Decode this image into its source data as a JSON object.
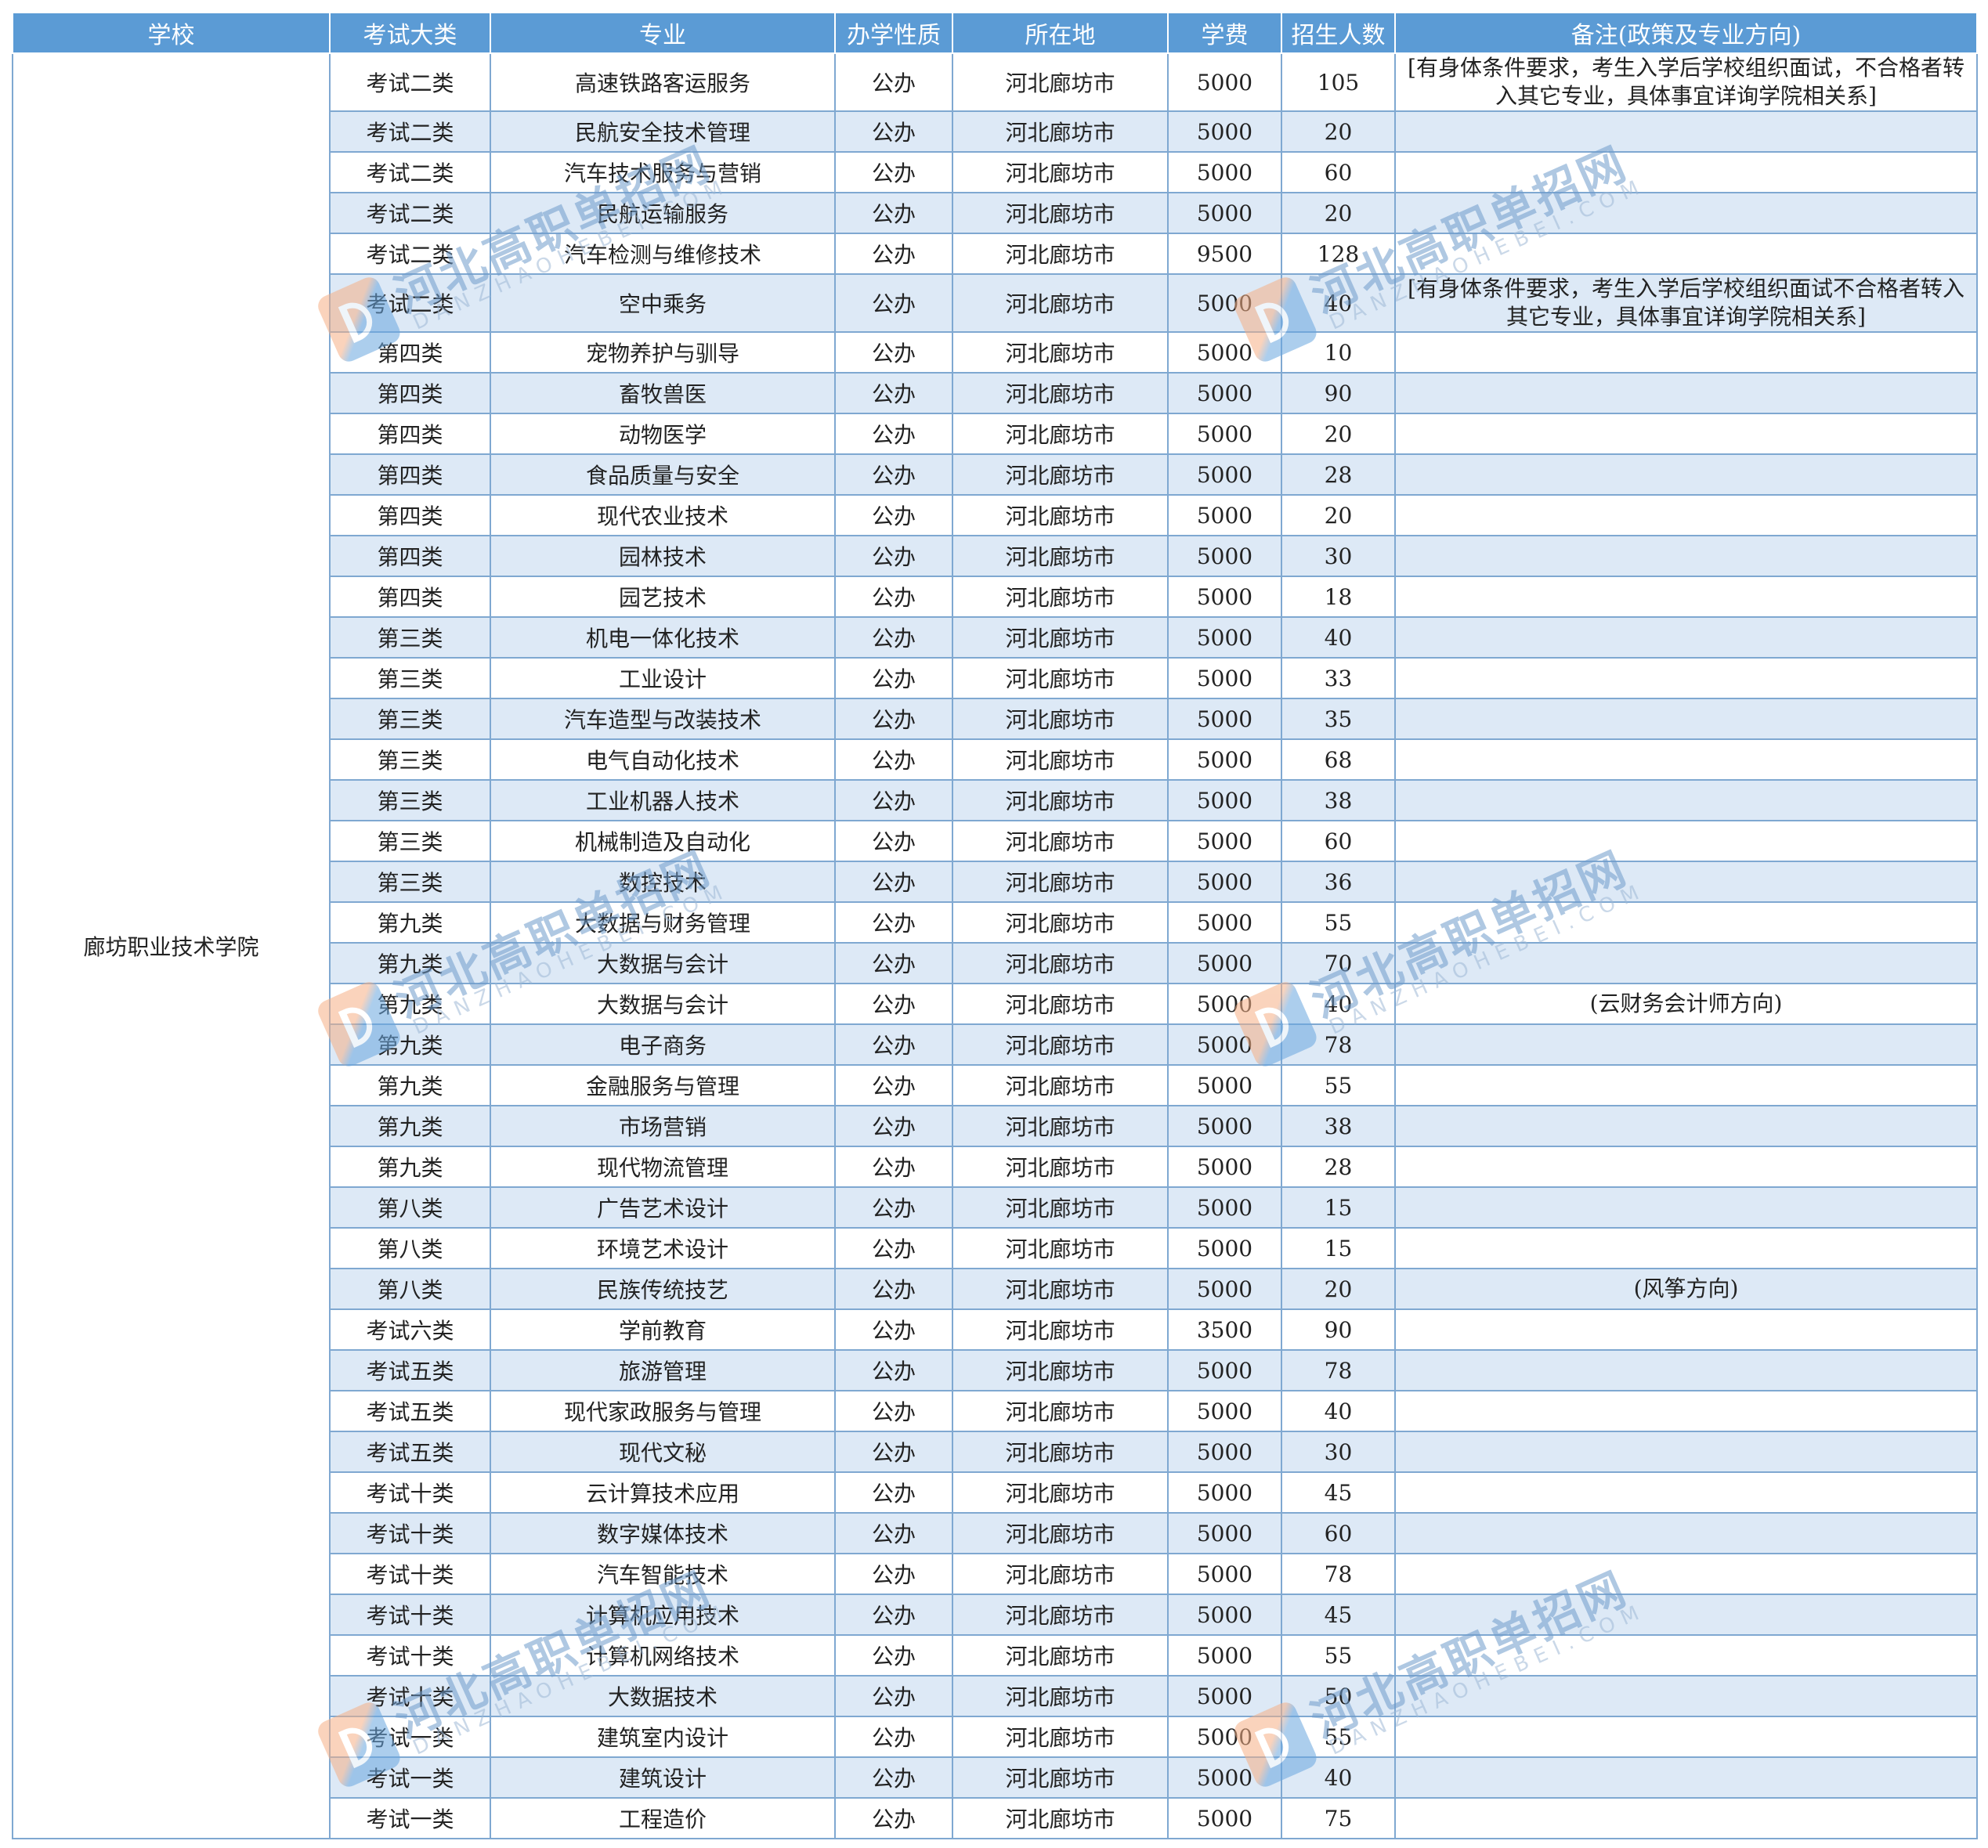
{
  "table": {
    "headers": [
      "学校",
      "考试大类",
      "专业",
      "办学性质",
      "所在地",
      "学费",
      "招生人数",
      "备注(政策及专业方向)"
    ],
    "school": "廊坊职业技术学院",
    "rows": [
      {
        "category": "考试二类",
        "major": "高速铁路客运服务",
        "nature": "公办",
        "location": "河北廊坊市",
        "fee": "5000",
        "count": "105",
        "note": "[有身体条件要求，考生入学后学校组织面试，不合格者转入其它专业，具体事宜详询学院相关系]"
      },
      {
        "category": "考试二类",
        "major": "民航安全技术管理",
        "nature": "公办",
        "location": "河北廊坊市",
        "fee": "5000",
        "count": "20",
        "note": ""
      },
      {
        "category": "考试二类",
        "major": "汽车技术服务与营销",
        "nature": "公办",
        "location": "河北廊坊市",
        "fee": "5000",
        "count": "60",
        "note": ""
      },
      {
        "category": "考试二类",
        "major": "民航运输服务",
        "nature": "公办",
        "location": "河北廊坊市",
        "fee": "5000",
        "count": "20",
        "note": ""
      },
      {
        "category": "考试二类",
        "major": "汽车检测与维修技术",
        "nature": "公办",
        "location": "河北廊坊市",
        "fee": "9500",
        "count": "128",
        "note": ""
      },
      {
        "category": "考试二类",
        "major": "空中乘务",
        "nature": "公办",
        "location": "河北廊坊市",
        "fee": "5000",
        "count": "40",
        "note": "[有身体条件要求，考生入学后学校组织面试不合格者转入其它专业，具体事宜详询学院相关系]"
      },
      {
        "category": "第四类",
        "major": "宠物养护与驯导",
        "nature": "公办",
        "location": "河北廊坊市",
        "fee": "5000",
        "count": "10",
        "note": ""
      },
      {
        "category": "第四类",
        "major": "畜牧兽医",
        "nature": "公办",
        "location": "河北廊坊市",
        "fee": "5000",
        "count": "90",
        "note": ""
      },
      {
        "category": "第四类",
        "major": "动物医学",
        "nature": "公办",
        "location": "河北廊坊市",
        "fee": "5000",
        "count": "20",
        "note": ""
      },
      {
        "category": "第四类",
        "major": "食品质量与安全",
        "nature": "公办",
        "location": "河北廊坊市",
        "fee": "5000",
        "count": "28",
        "note": ""
      },
      {
        "category": "第四类",
        "major": "现代农业技术",
        "nature": "公办",
        "location": "河北廊坊市",
        "fee": "5000",
        "count": "20",
        "note": ""
      },
      {
        "category": "第四类",
        "major": "园林技术",
        "nature": "公办",
        "location": "河北廊坊市",
        "fee": "5000",
        "count": "30",
        "note": ""
      },
      {
        "category": "第四类",
        "major": "园艺技术",
        "nature": "公办",
        "location": "河北廊坊市",
        "fee": "5000",
        "count": "18",
        "note": ""
      },
      {
        "category": "第三类",
        "major": "机电一体化技术",
        "nature": "公办",
        "location": "河北廊坊市",
        "fee": "5000",
        "count": "40",
        "note": ""
      },
      {
        "category": "第三类",
        "major": "工业设计",
        "nature": "公办",
        "location": "河北廊坊市",
        "fee": "5000",
        "count": "33",
        "note": ""
      },
      {
        "category": "第三类",
        "major": "汽车造型与改装技术",
        "nature": "公办",
        "location": "河北廊坊市",
        "fee": "5000",
        "count": "35",
        "note": ""
      },
      {
        "category": "第三类",
        "major": "电气自动化技术",
        "nature": "公办",
        "location": "河北廊坊市",
        "fee": "5000",
        "count": "68",
        "note": ""
      },
      {
        "category": "第三类",
        "major": "工业机器人技术",
        "nature": "公办",
        "location": "河北廊坊市",
        "fee": "5000",
        "count": "38",
        "note": ""
      },
      {
        "category": "第三类",
        "major": "机械制造及自动化",
        "nature": "公办",
        "location": "河北廊坊市",
        "fee": "5000",
        "count": "60",
        "note": ""
      },
      {
        "category": "第三类",
        "major": "数控技术",
        "nature": "公办",
        "location": "河北廊坊市",
        "fee": "5000",
        "count": "36",
        "note": ""
      },
      {
        "category": "第九类",
        "major": "大数据与财务管理",
        "nature": "公办",
        "location": "河北廊坊市",
        "fee": "5000",
        "count": "55",
        "note": ""
      },
      {
        "category": "第九类",
        "major": "大数据与会计",
        "nature": "公办",
        "location": "河北廊坊市",
        "fee": "5000",
        "count": "70",
        "note": ""
      },
      {
        "category": "第九类",
        "major": "大数据与会计",
        "nature": "公办",
        "location": "河北廊坊市",
        "fee": "5000",
        "count": "40",
        "note": "(云财务会计师方向)"
      },
      {
        "category": "第九类",
        "major": "电子商务",
        "nature": "公办",
        "location": "河北廊坊市",
        "fee": "5000",
        "count": "78",
        "note": ""
      },
      {
        "category": "第九类",
        "major": "金融服务与管理",
        "nature": "公办",
        "location": "河北廊坊市",
        "fee": "5000",
        "count": "55",
        "note": ""
      },
      {
        "category": "第九类",
        "major": "市场营销",
        "nature": "公办",
        "location": "河北廊坊市",
        "fee": "5000",
        "count": "38",
        "note": ""
      },
      {
        "category": "第九类",
        "major": "现代物流管理",
        "nature": "公办",
        "location": "河北廊坊市",
        "fee": "5000",
        "count": "28",
        "note": ""
      },
      {
        "category": "第八类",
        "major": "广告艺术设计",
        "nature": "公办",
        "location": "河北廊坊市",
        "fee": "5000",
        "count": "15",
        "note": ""
      },
      {
        "category": "第八类",
        "major": "环境艺术设计",
        "nature": "公办",
        "location": "河北廊坊市",
        "fee": "5000",
        "count": "15",
        "note": ""
      },
      {
        "category": "第八类",
        "major": "民族传统技艺",
        "nature": "公办",
        "location": "河北廊坊市",
        "fee": "5000",
        "count": "20",
        "note": "(风筝方向)"
      },
      {
        "category": "考试六类",
        "major": "学前教育",
        "nature": "公办",
        "location": "河北廊坊市",
        "fee": "3500",
        "count": "90",
        "note": ""
      },
      {
        "category": "考试五类",
        "major": "旅游管理",
        "nature": "公办",
        "location": "河北廊坊市",
        "fee": "5000",
        "count": "78",
        "note": ""
      },
      {
        "category": "考试五类",
        "major": "现代家政服务与管理",
        "nature": "公办",
        "location": "河北廊坊市",
        "fee": "5000",
        "count": "40",
        "note": ""
      },
      {
        "category": "考试五类",
        "major": "现代文秘",
        "nature": "公办",
        "location": "河北廊坊市",
        "fee": "5000",
        "count": "30",
        "note": ""
      },
      {
        "category": "考试十类",
        "major": "云计算技术应用",
        "nature": "公办",
        "location": "河北廊坊市",
        "fee": "5000",
        "count": "45",
        "note": ""
      },
      {
        "category": "考试十类",
        "major": "数字媒体技术",
        "nature": "公办",
        "location": "河北廊坊市",
        "fee": "5000",
        "count": "60",
        "note": ""
      },
      {
        "category": "考试十类",
        "major": "汽车智能技术",
        "nature": "公办",
        "location": "河北廊坊市",
        "fee": "5000",
        "count": "78",
        "note": ""
      },
      {
        "category": "考试十类",
        "major": "计算机应用技术",
        "nature": "公办",
        "location": "河北廊坊市",
        "fee": "5000",
        "count": "45",
        "note": ""
      },
      {
        "category": "考试十类",
        "major": "计算机网络技术",
        "nature": "公办",
        "location": "河北廊坊市",
        "fee": "5000",
        "count": "55",
        "note": ""
      },
      {
        "category": "考试十类",
        "major": "大数据技术",
        "nature": "公办",
        "location": "河北廊坊市",
        "fee": "5000",
        "count": "50",
        "note": ""
      },
      {
        "category": "考试一类",
        "major": "建筑室内设计",
        "nature": "公办",
        "location": "河北廊坊市",
        "fee": "5000",
        "count": "55",
        "note": ""
      },
      {
        "category": "考试一类",
        "major": "建筑设计",
        "nature": "公办",
        "location": "河北廊坊市",
        "fee": "5000",
        "count": "40",
        "note": ""
      },
      {
        "category": "考试一类",
        "major": "工程造价",
        "nature": "公办",
        "location": "河北廊坊市",
        "fee": "5000",
        "count": "75",
        "note": ""
      }
    ]
  },
  "watermark": {
    "title": "河北高职单招网",
    "subtitle": "DANZHAOHEBEI.COM",
    "logo_icon": "d-letter-logo-icon"
  },
  "colors": {
    "header_bg": "#5b9bd5",
    "row_stripe": "#dde9f6",
    "border": "#7fa8d1"
  }
}
